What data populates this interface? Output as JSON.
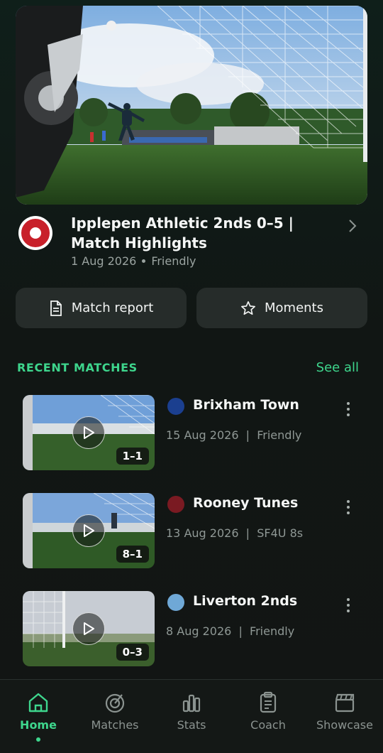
{
  "featured": {
    "title": "Ipplepen Athletic 2nds 0–5 | Match Highlights",
    "date": "1 Aug 2026",
    "type": "Friendly",
    "club_badge_icon": "ipplepen-athletic-badge",
    "actions": {
      "match_report": "Match report",
      "moments": "Moments"
    }
  },
  "recent": {
    "section_title": "RECENT MATCHES",
    "see_all": "See all",
    "matches": [
      {
        "team": "Brixham Town",
        "date": "15 Aug 2026",
        "type": "Friendly",
        "score": "1–1",
        "badge_color": "#1b3f8f"
      },
      {
        "team": "Rooney Tunes",
        "date": "13 Aug 2026",
        "type": "SF4U 8s",
        "score": "8–1",
        "badge_color": "#7a1a22"
      },
      {
        "team": "Liverton 2nds",
        "date": "8 Aug 2026",
        "type": "Friendly",
        "score": "0–3",
        "badge_color": "#6fa8d6"
      }
    ]
  },
  "nav": {
    "items": [
      {
        "label": "Home",
        "icon": "home-icon"
      },
      {
        "label": "Matches",
        "icon": "matches-icon"
      },
      {
        "label": "Stats",
        "icon": "stats-icon"
      },
      {
        "label": "Coach",
        "icon": "clipboard-icon"
      },
      {
        "label": "Showcase",
        "icon": "clapperboard-icon"
      }
    ],
    "active": "Home"
  },
  "colors": {
    "accent": "#3ed68d",
    "card": "#262c2a",
    "background": "#121514"
  }
}
